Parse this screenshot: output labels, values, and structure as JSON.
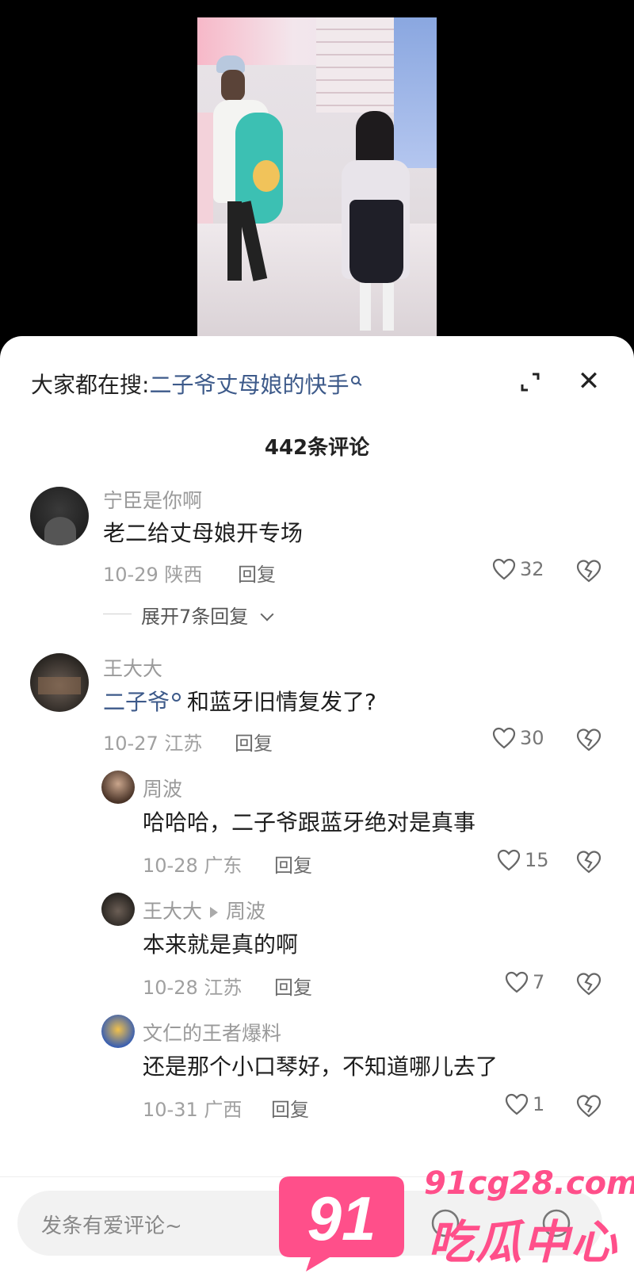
{
  "search_bar": {
    "prefix": "大家都在搜:",
    "term": "二子爷丈母娘的快手"
  },
  "comment_count_label": "442条评论",
  "comments": [
    {
      "username": "宁臣是你啊",
      "text": "老二给丈母娘开专场",
      "date": "10-29",
      "location": "陕西",
      "reply_label": "回复",
      "likes": "32",
      "expand_label": "展开7条回复"
    },
    {
      "username": "王大大",
      "mention": "二子爷",
      "text": "和蓝牙旧情复发了?",
      "date": "10-27",
      "location": "江苏",
      "reply_label": "回复",
      "likes": "30",
      "replies": [
        {
          "username": "周波",
          "text": "哈哈哈，二子爷跟蓝牙绝对是真事",
          "date": "10-28",
          "location": "广东",
          "reply_label": "回复",
          "likes": "15"
        },
        {
          "username": "王大大",
          "reply_to": "周波",
          "text": "本来就是真的啊",
          "date": "10-28",
          "location": "江苏",
          "reply_label": "回复",
          "likes": "7"
        },
        {
          "username": "文仁的王者爆料",
          "text": "还是那个小口琴好，不知道哪儿去了",
          "date": "10-31",
          "location": "广西",
          "reply_label": "回复",
          "likes": "1"
        }
      ]
    }
  ],
  "input": {
    "placeholder": "发条有爱评论~"
  },
  "watermark": {
    "badge": "91",
    "url": "91cg28.com",
    "text": "吃瓜中心",
    "color": "#ff4f8a"
  },
  "colors": {
    "link": "#3d5a8a",
    "meta": "#a0a0a0"
  }
}
